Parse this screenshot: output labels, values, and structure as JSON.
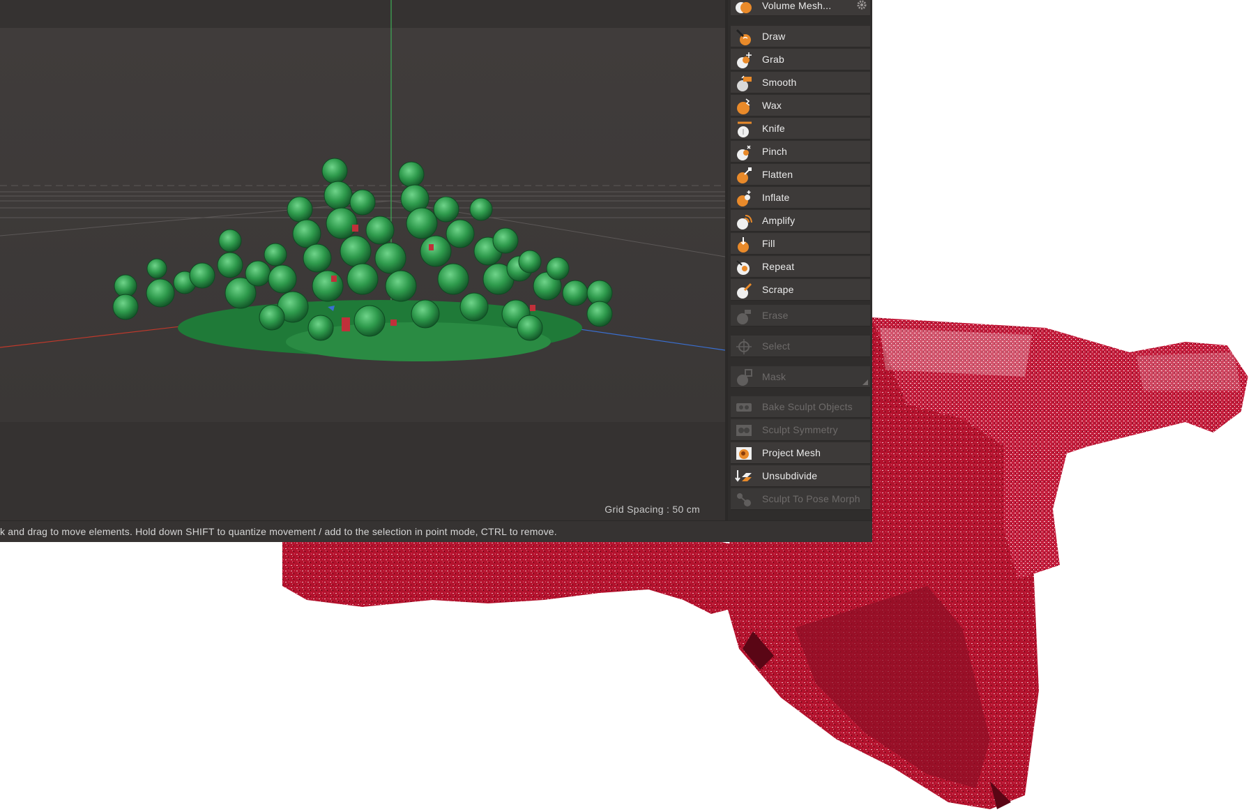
{
  "viewport": {
    "grid_spacing": "Grid Spacing : 50 cm"
  },
  "status_bar": {
    "text": "k and drag to move elements. Hold down SHIFT to quantize movement / add to the selection in point mode, CTRL to remove."
  },
  "palette": {
    "header": {
      "label": "Volume Mesh...",
      "icon": "volume-mesh-icon"
    },
    "tools": [
      {
        "label": "Draw",
        "icon": "draw-icon",
        "enabled": true
      },
      {
        "label": "Grab",
        "icon": "grab-icon",
        "enabled": true
      },
      {
        "label": "Smooth",
        "icon": "smooth-icon",
        "enabled": true
      },
      {
        "label": "Wax",
        "icon": "wax-icon",
        "enabled": true
      },
      {
        "label": "Knife",
        "icon": "knife-icon",
        "enabled": true
      },
      {
        "label": "Pinch",
        "icon": "pinch-icon",
        "enabled": true
      },
      {
        "label": "Flatten",
        "icon": "flatten-icon",
        "enabled": true
      },
      {
        "label": "Inflate",
        "icon": "inflate-icon",
        "enabled": true
      },
      {
        "label": "Amplify",
        "icon": "amplify-icon",
        "enabled": true
      },
      {
        "label": "Fill",
        "icon": "fill-icon",
        "enabled": true
      },
      {
        "label": "Repeat",
        "icon": "repeat-icon",
        "enabled": true
      },
      {
        "label": "Scrape",
        "icon": "scrape-icon",
        "enabled": true
      }
    ],
    "modes": [
      {
        "label": "Erase",
        "icon": "erase-icon",
        "enabled": false
      },
      {
        "label": "Select",
        "icon": "select-icon",
        "enabled": false
      },
      {
        "label": "Mask",
        "icon": "mask-icon",
        "enabled": false
      }
    ],
    "commands": [
      {
        "label": "Bake Sculpt Objects",
        "icon": "bake-sculpt-icon",
        "enabled": false
      },
      {
        "label": "Sculpt Symmetry",
        "icon": "sculpt-symmetry-icon",
        "enabled": false
      },
      {
        "label": "Project Mesh",
        "icon": "project-mesh-icon",
        "enabled": true
      },
      {
        "label": "Unsubdivide",
        "icon": "unsubdivide-icon",
        "enabled": true
      },
      {
        "label": "Sculpt To Pose Morph",
        "icon": "pose-morph-icon",
        "enabled": false
      }
    ]
  },
  "colors": {
    "accent_orange": "#e98a2a",
    "model_green": "#2f9a4a",
    "cloud_red": "#b0152e"
  }
}
